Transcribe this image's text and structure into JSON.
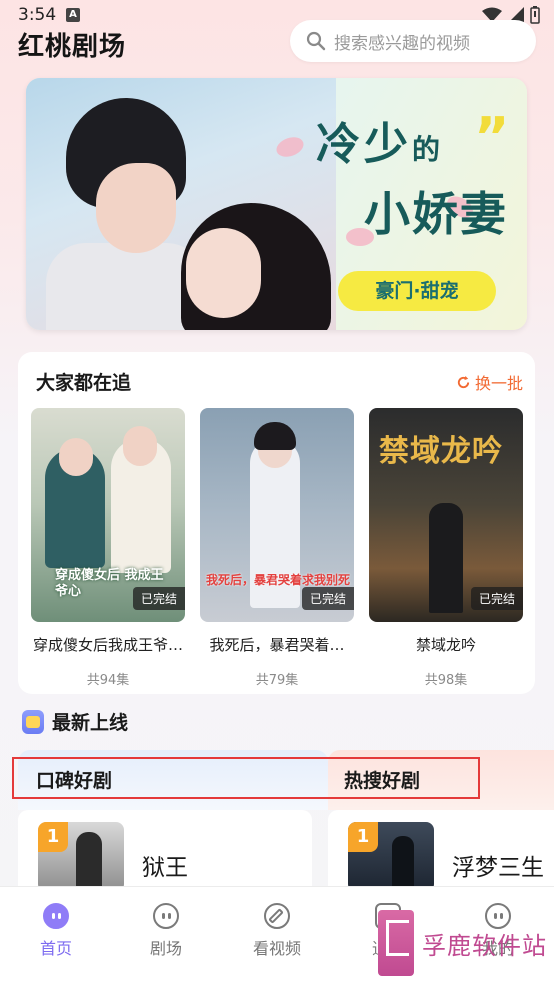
{
  "status": {
    "time": "3:54",
    "notif_letter": "A"
  },
  "header": {
    "app_title": "红桃剧场",
    "search_placeholder": "搜索感兴趣的视频"
  },
  "banner": {
    "title_line1_a": "冷少",
    "title_line1_b": "的",
    "title_line2": "小娇妻",
    "tag": "豪门·甜宠"
  },
  "trending": {
    "title": "大家都在追",
    "refresh_label": "换一批",
    "items": [
      {
        "name": "穿成傻女后我成王爷…",
        "badge": "已完结",
        "episodes": "共94集",
        "poster_text": "穿成傻女后 我成王爷心"
      },
      {
        "name": "我死后，暴君哭着…",
        "badge": "已完结",
        "episodes": "共79集",
        "poster_text": "我死后，暴君哭着求我别死"
      },
      {
        "name": "禁域龙吟",
        "badge": "已完结",
        "episodes": "共98集",
        "poster_text": "禁域龙吟"
      }
    ]
  },
  "new_releases": {
    "title": "最新上线"
  },
  "tabs": {
    "left": "口碑好剧",
    "right": "热搜好剧"
  },
  "rankings": {
    "left": {
      "rank": "1",
      "title": "狱王"
    },
    "right": {
      "rank": "1",
      "title": "浮梦三生"
    }
  },
  "nav": {
    "items": [
      {
        "label": "首页",
        "active": true
      },
      {
        "label": "剧场",
        "active": false
      },
      {
        "label": "看视频",
        "active": false
      },
      {
        "label": "追剧",
        "active": false
      },
      {
        "label": "我的",
        "active": false
      }
    ]
  },
  "watermark": {
    "text": "孚鹿软件站"
  },
  "colors": {
    "accent": "#7e6cf0",
    "refresh": "#f26a33",
    "highlight": "#e43a3a",
    "rank_badge": "#f7a52a"
  }
}
